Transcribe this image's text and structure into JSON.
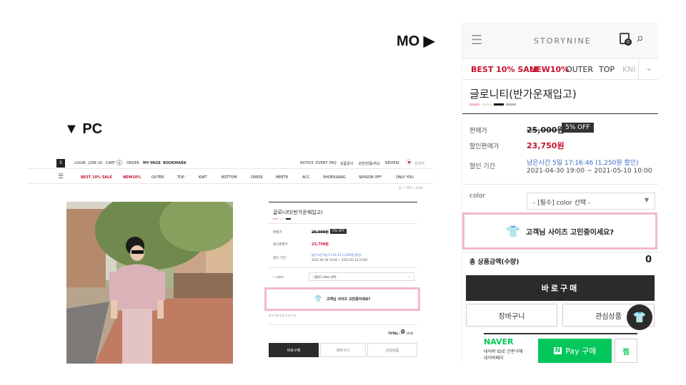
{
  "labels": {
    "mo": "MO ▶",
    "pc": "▼ PC"
  },
  "pc": {
    "top_left": [
      "LOGIN",
      "JOIN US",
      "CART",
      "ORDER",
      "MY PAGE",
      "BOOKMARK"
    ],
    "cart_count": "0",
    "logo": "S",
    "top_right": [
      "NOTICE",
      "EVENT",
      "FAQ",
      "상품문의",
      "교환/반품/취소",
      "REVIEW",
      "한국어"
    ],
    "menu": [
      "BEST 10% SALE",
      "NEW10%",
      "OUTER",
      "TOP",
      "KNIT",
      "BOTTOM",
      "DRESS",
      "MEET9",
      "ACC",
      "SHOES&BAG",
      "SEASON OFF",
      "ONLY YOU"
    ],
    "breadcrumb": "홈 > TOP > 티셔츠",
    "product_title": "글로니티(반가운재입고)",
    "price_label": "판매가",
    "price": "25,000원",
    "discount_badge": "5% OFF",
    "sale_label": "할인판매가",
    "sale_price": "23,750원",
    "period_label": "할인 기간",
    "period_remaining": "남은시간 5일 17:21:13 (1,250원 할인)",
    "period_range": "2021-04-30 19:00 ~ 2021-05-10 10:00",
    "color_label": "• color",
    "color_select": "- [필수] color 선택 -",
    "size_banner": "고객님 사이즈 고민중이세요?",
    "min_order": "최소주문수량 1개 이상",
    "total_label": "TOTAL :",
    "total_value": "0",
    "total_unit": "(0개)",
    "buy_button": "바로구매",
    "cart_button": "장바구니",
    "wish_button": "관심상품"
  },
  "mo": {
    "brand": "STORYNINE",
    "cart_count": "0",
    "categories": [
      "BEST 10% SALE",
      "NEW10%",
      "OUTER",
      "TOP",
      "KNI"
    ],
    "product_title": "글로니티(반가운재입고)",
    "price_label": "판매가",
    "price": "25,000원",
    "discount_badge": "5% OFF",
    "sale_label": "할인판매가",
    "sale_price": "23,750원",
    "period_label": "할인 기간",
    "period_remaining": "남은시간 5일 17:16:46 (1,250원 할인)",
    "period_range": "2021-04-30 19:00 ~ 2021-05-10 10:00",
    "color_label": "color",
    "color_select": "- [필수] color 선택 -",
    "size_banner": "고객님 사이즈 고민중이세요?",
    "total_label": "총 상품금액(수량)",
    "total_value": "0",
    "buy_button": "바로구매",
    "cart_button": "장바구니",
    "wish_button": "관심상품",
    "naver_brand": "NAVER",
    "naver_text1": "네이버 ID로 간편구매",
    "naver_text2": "네이버페이",
    "npay_button": "Pay 구매",
    "npay_n": "N",
    "zzim_button": "찜"
  },
  "colors": {
    "accent_red": "#c8102e",
    "pink_border": "#f3b8cc",
    "dark": "#2b2b2b",
    "npay_green": "#03c75a"
  }
}
